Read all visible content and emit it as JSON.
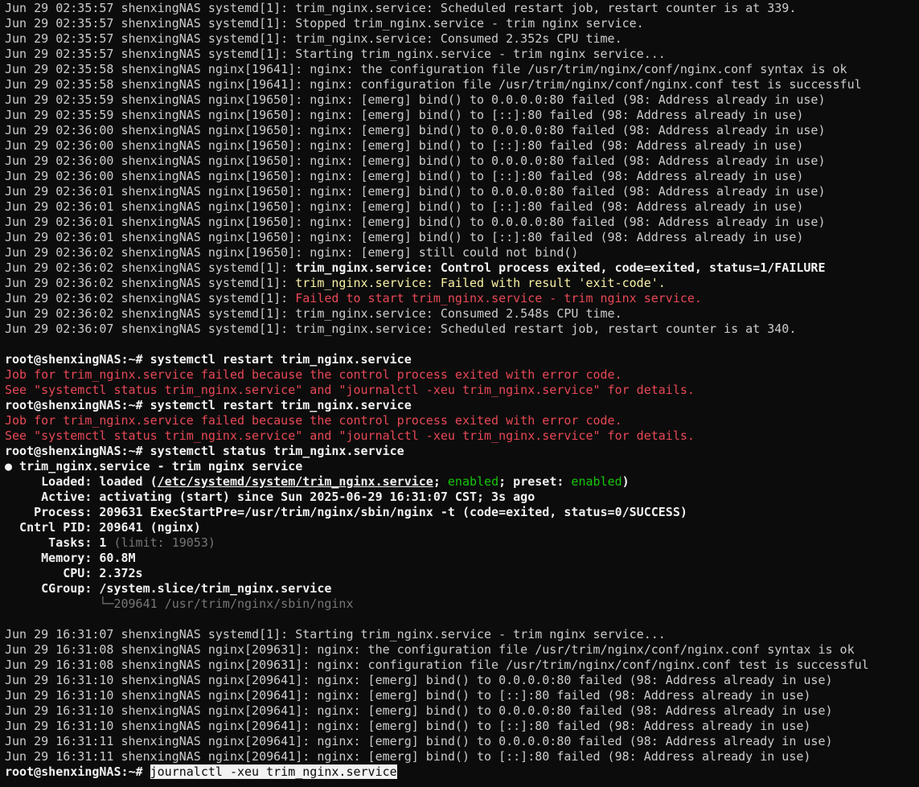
{
  "colors": {
    "background": "#0c0c0c",
    "text": "#cccccc",
    "bold": "#f2f2f2",
    "warning": "#f9f1a5",
    "error": "#e74856",
    "enabled": "#16c60c",
    "dim": "#767676"
  },
  "lines": [
    [
      {
        "t": "Jun 29 02:35:57 shenxingNAS systemd[1]: trim_nginx.service: Scheduled restart job, restart counter is at 339."
      }
    ],
    [
      {
        "t": "Jun 29 02:35:57 shenxingNAS systemd[1]: Stopped trim_nginx.service - trim nginx service."
      }
    ],
    [
      {
        "t": "Jun 29 02:35:57 shenxingNAS systemd[1]: trim_nginx.service: Consumed 2.352s CPU time."
      }
    ],
    [
      {
        "t": "Jun 29 02:35:57 shenxingNAS systemd[1]: Starting trim_nginx.service - trim nginx service..."
      }
    ],
    [
      {
        "t": "Jun 29 02:35:58 shenxingNAS nginx[19641]: nginx: the configuration file /usr/trim/nginx/conf/nginx.conf syntax is ok"
      }
    ],
    [
      {
        "t": "Jun 29 02:35:58 shenxingNAS nginx[19641]: nginx: configuration file /usr/trim/nginx/conf/nginx.conf test is successful"
      }
    ],
    [
      {
        "t": "Jun 29 02:35:59 shenxingNAS nginx[19650]: nginx: [emerg] bind() to 0.0.0.0:80 failed (98: Address already in use)"
      }
    ],
    [
      {
        "t": "Jun 29 02:35:59 shenxingNAS nginx[19650]: nginx: [emerg] bind() to [::]:80 failed (98: Address already in use)"
      }
    ],
    [
      {
        "t": "Jun 29 02:36:00 shenxingNAS nginx[19650]: nginx: [emerg] bind() to 0.0.0.0:80 failed (98: Address already in use)"
      }
    ],
    [
      {
        "t": "Jun 29 02:36:00 shenxingNAS nginx[19650]: nginx: [emerg] bind() to [::]:80 failed (98: Address already in use)"
      }
    ],
    [
      {
        "t": "Jun 29 02:36:00 shenxingNAS nginx[19650]: nginx: [emerg] bind() to 0.0.0.0:80 failed (98: Address already in use)"
      }
    ],
    [
      {
        "t": "Jun 29 02:36:00 shenxingNAS nginx[19650]: nginx: [emerg] bind() to [::]:80 failed (98: Address already in use)"
      }
    ],
    [
      {
        "t": "Jun 29 02:36:01 shenxingNAS nginx[19650]: nginx: [emerg] bind() to 0.0.0.0:80 failed (98: Address already in use)"
      }
    ],
    [
      {
        "t": "Jun 29 02:36:01 shenxingNAS nginx[19650]: nginx: [emerg] bind() to [::]:80 failed (98: Address already in use)"
      }
    ],
    [
      {
        "t": "Jun 29 02:36:01 shenxingNAS nginx[19650]: nginx: [emerg] bind() to 0.0.0.0:80 failed (98: Address already in use)"
      }
    ],
    [
      {
        "t": "Jun 29 02:36:01 shenxingNAS nginx[19650]: nginx: [emerg] bind() to [::]:80 failed (98: Address already in use)"
      }
    ],
    [
      {
        "t": "Jun 29 02:36:02 shenxingNAS nginx[19650]: nginx: [emerg] still could not bind()"
      }
    ],
    [
      {
        "t": "Jun 29 02:36:02 shenxingNAS systemd[1]: "
      },
      {
        "t": "trim_nginx.service: Control process exited, code=exited, status=1/FAILURE",
        "s": "bold"
      }
    ],
    [
      {
        "t": "Jun 29 02:36:02 shenxingNAS systemd[1]: "
      },
      {
        "t": "trim_nginx.service: Failed with result 'exit-code'.",
        "s": "yellow"
      }
    ],
    [
      {
        "t": "Jun 29 02:36:02 shenxingNAS systemd[1]: "
      },
      {
        "t": "Failed to start trim_nginx.service - trim nginx service.",
        "s": "red"
      }
    ],
    [
      {
        "t": "Jun 29 02:36:02 shenxingNAS systemd[1]: trim_nginx.service: Consumed 2.548s CPU time."
      }
    ],
    [
      {
        "t": "Jun 29 02:36:07 shenxingNAS systemd[1]: trim_nginx.service: Scheduled restart job, restart counter is at 340."
      }
    ],
    [
      {
        "t": ""
      }
    ],
    [
      {
        "t": "root@shenxingNAS:~# ",
        "s": "prompt"
      },
      {
        "t": "systemctl restart trim_nginx.service",
        "s": "bold"
      }
    ],
    [
      {
        "t": "Job for trim_nginx.service failed because the control process exited with error code.",
        "s": "red"
      }
    ],
    [
      {
        "t": "See \"systemctl status trim_nginx.service\" and \"journalctl -xeu trim_nginx.service\" for details.",
        "s": "red"
      }
    ],
    [
      {
        "t": "root@shenxingNAS:~# ",
        "s": "prompt"
      },
      {
        "t": "systemctl restart trim_nginx.service",
        "s": "bold"
      }
    ],
    [
      {
        "t": "Job for trim_nginx.service failed because the control process exited with error code.",
        "s": "red"
      }
    ],
    [
      {
        "t": "See \"systemctl status trim_nginx.service\" and \"journalctl -xeu trim_nginx.service\" for details.",
        "s": "red"
      }
    ],
    [
      {
        "t": "root@shenxingNAS:~# ",
        "s": "prompt"
      },
      {
        "t": "systemctl status trim_nginx.service",
        "s": "bold"
      }
    ],
    [
      {
        "t": "● trim_nginx.service - trim nginx service",
        "s": "bold"
      }
    ],
    [
      {
        "t": "     Loaded: loaded (",
        "s": "bold"
      },
      {
        "t": "/etc/systemd/system/trim_nginx.service",
        "s": "underline"
      },
      {
        "t": "; ",
        "s": "bold"
      },
      {
        "t": "enabled",
        "s": "green"
      },
      {
        "t": "; preset: ",
        "s": "bold"
      },
      {
        "t": "enabled",
        "s": "green"
      },
      {
        "t": ")",
        "s": "bold"
      }
    ],
    [
      {
        "t": "     Active: activating (start) since Sun 2025-06-29 16:31:07 CST; 3s ago",
        "s": "bold"
      }
    ],
    [
      {
        "t": "    Process: 209631 ExecStartPre=/usr/trim/nginx/sbin/nginx -t (code=exited, status=0/SUCCESS)",
        "s": "bold"
      }
    ],
    [
      {
        "t": "  Cntrl PID: 209641 (nginx)",
        "s": "bold"
      }
    ],
    [
      {
        "t": "      Tasks: 1 ",
        "s": "bold"
      },
      {
        "t": "(limit: 19053)",
        "s": "dim"
      }
    ],
    [
      {
        "t": "     Memory: 60.8M",
        "s": "bold"
      }
    ],
    [
      {
        "t": "        CPU: 2.372s",
        "s": "bold"
      }
    ],
    [
      {
        "t": "     CGroup: /system.slice/trim_nginx.service",
        "s": "bold"
      }
    ],
    [
      {
        "t": "             └─209641 /usr/trim/nginx/sbin/nginx",
        "s": "dim"
      }
    ],
    [
      {
        "t": ""
      }
    ],
    [
      {
        "t": "Jun 29 16:31:07 shenxingNAS systemd[1]: Starting trim_nginx.service - trim nginx service..."
      }
    ],
    [
      {
        "t": "Jun 29 16:31:08 shenxingNAS nginx[209631]: nginx: the configuration file /usr/trim/nginx/conf/nginx.conf syntax is ok"
      }
    ],
    [
      {
        "t": "Jun 29 16:31:08 shenxingNAS nginx[209631]: nginx: configuration file /usr/trim/nginx/conf/nginx.conf test is successful"
      }
    ],
    [
      {
        "t": "Jun 29 16:31:10 shenxingNAS nginx[209641]: nginx: [emerg] bind() to 0.0.0.0:80 failed (98: Address already in use)"
      }
    ],
    [
      {
        "t": "Jun 29 16:31:10 shenxingNAS nginx[209641]: nginx: [emerg] bind() to [::]:80 failed (98: Address already in use)"
      }
    ],
    [
      {
        "t": "Jun 29 16:31:10 shenxingNAS nginx[209641]: nginx: [emerg] bind() to 0.0.0.0:80 failed (98: Address already in use)"
      }
    ],
    [
      {
        "t": "Jun 29 16:31:10 shenxingNAS nginx[209641]: nginx: [emerg] bind() to [::]:80 failed (98: Address already in use)"
      }
    ],
    [
      {
        "t": "Jun 29 16:31:11 shenxingNAS nginx[209641]: nginx: [emerg] bind() to 0.0.0.0:80 failed (98: Address already in use)"
      }
    ],
    [
      {
        "t": "Jun 29 16:31:11 shenxingNAS nginx[209641]: nginx: [emerg] bind() to [::]:80 failed (98: Address already in use)"
      }
    ],
    [
      {
        "t": "root@shenxingNAS:~# ",
        "s": "prompt"
      },
      {
        "t": "journalctl -xeu trim_nginx.service",
        "s": "selected"
      }
    ]
  ]
}
